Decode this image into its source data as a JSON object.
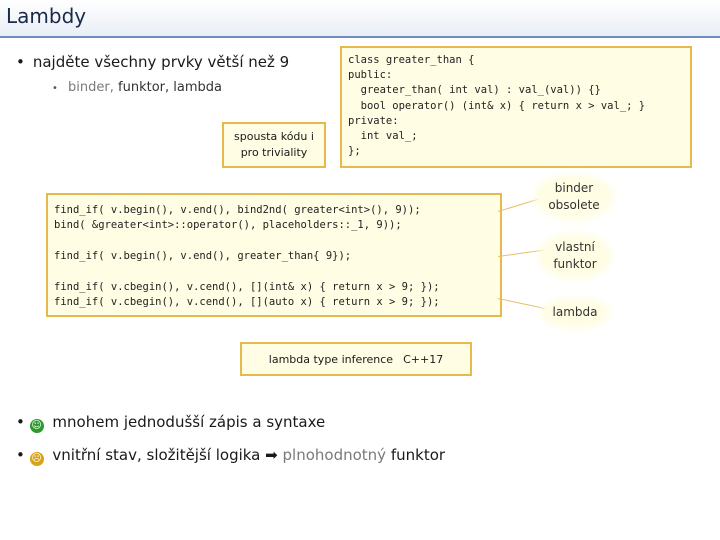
{
  "slide": {
    "title": "Lambdy",
    "bullet_main": "najděte všechny prvky větší než 9",
    "sub_binder": "binder,",
    "sub_funktor": "funktor,",
    "sub_lambda": "lambda",
    "note": "spousta kódu i pro triviality",
    "class_code": "class greater_than {\npublic:\n  greater_than( int val) : val_(val)) {}\n  bool operator() (int& x) { return x > val_; }\nprivate:\n  int val_;\n};",
    "find_bind": "find_if( v.begin(), v.end(), bind2nd( greater<int>(), 9));\nbind( &greater<int>::operator(), placeholders::_1, 9));",
    "find_functor": "find_if( v.begin(), v.end(), greater_than{ 9});",
    "find_lambda": "find_if( v.cbegin(), v.cend(), [](int& x) { return x > 9; });\nfind_if( v.cbegin(), v.cend(), [](auto x) { return x > 9; });",
    "inference_label": "lambda type inference",
    "inference_version": "C++17",
    "callout_binder": "binder obsolete",
    "callout_functor": "vlastní funktor",
    "callout_lambda": "lambda",
    "pro_text": "mnohem jednodušší zápis a syntaxe",
    "con_text_1": "vnitřní stav, složitější logika",
    "con_arrow": "➡",
    "con_text_2": "plnohodnotný",
    "con_text_3": "funktor"
  },
  "colors": {
    "accent_border": "#e7b84c",
    "box_fill": "#fffde3",
    "smile": "#2e9a2e",
    "frown": "#d9a21a"
  }
}
